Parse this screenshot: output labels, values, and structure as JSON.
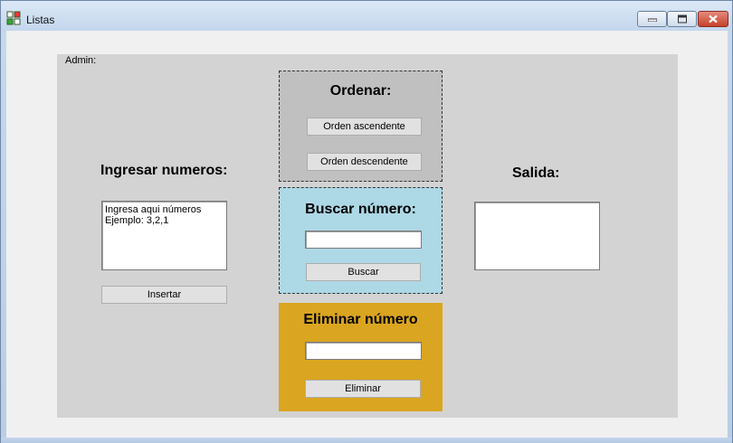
{
  "window": {
    "title": "Listas",
    "icon": "grid-app-icon",
    "controls": [
      "minimize-icon",
      "maximize-icon",
      "close-icon"
    ]
  },
  "form": {
    "admin_label": "Admin:",
    "input_section": {
      "label": "Ingresar numeros:",
      "textarea_text": "Ingresa aqui números\nEjemplo: 3,2,1",
      "insert_button": "Insertar"
    },
    "ordenar": {
      "title": "Ordenar:",
      "asc_button": "Orden ascendente",
      "desc_button": "Orden descendente",
      "bg_color": "#c0c0c0"
    },
    "buscar": {
      "title": "Buscar número:",
      "input_value": "",
      "button": "Buscar",
      "bg_color": "#add8e6"
    },
    "eliminar": {
      "title": "Eliminar número",
      "input_value": "",
      "button": "Eliminar",
      "bg_color": "#daa520"
    },
    "salida": {
      "label": "Salida:",
      "output_value": ""
    }
  }
}
